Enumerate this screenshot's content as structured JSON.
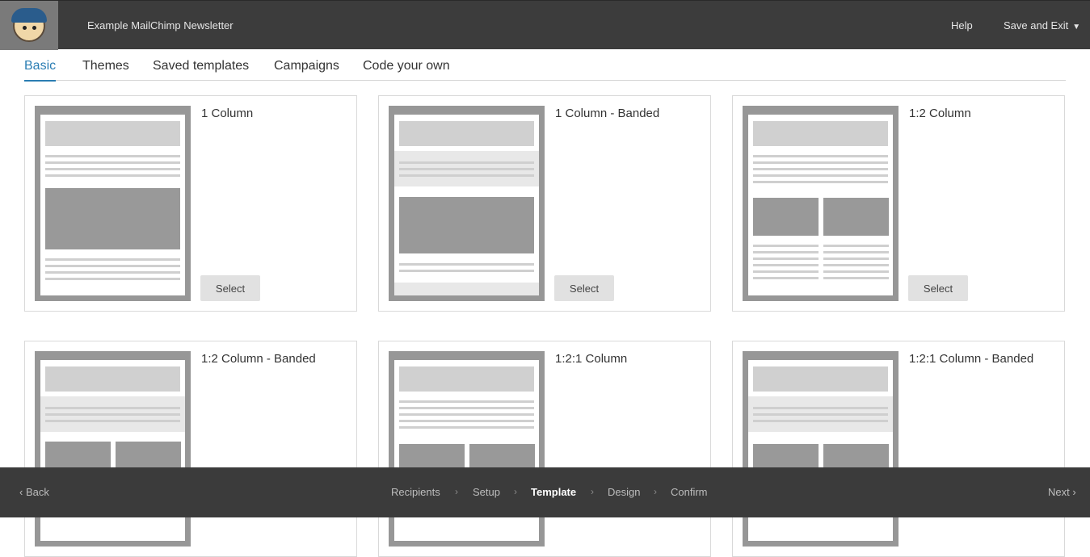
{
  "header": {
    "logo_icon": "mailchimp-logo-icon",
    "title": "Example MailChimp Newsletter",
    "help": "Help",
    "save_exit": "Save and Exit"
  },
  "tabs": [
    {
      "label": "Basic",
      "active": true
    },
    {
      "label": "Themes"
    },
    {
      "label": "Saved templates"
    },
    {
      "label": "Campaigns"
    },
    {
      "label": "Code your own"
    }
  ],
  "templates": [
    {
      "name": "1 Column",
      "button": "Select"
    },
    {
      "name": "1 Column - Banded",
      "button": "Select"
    },
    {
      "name": "1:2 Column",
      "button": "Select"
    },
    {
      "name": "1:2 Column - Banded"
    },
    {
      "name": "1:2:1 Column"
    },
    {
      "name": "1:2:1 Column - Banded"
    }
  ],
  "footer": {
    "back": "Back",
    "steps": [
      "Recipients",
      "Setup",
      "Template",
      "Design",
      "Confirm"
    ],
    "current_step": "Template",
    "next": "Next"
  },
  "colors": {
    "topbar": "#3c3c3c",
    "accent": "#2a7db3",
    "bottombar": "#3b3b3b"
  }
}
